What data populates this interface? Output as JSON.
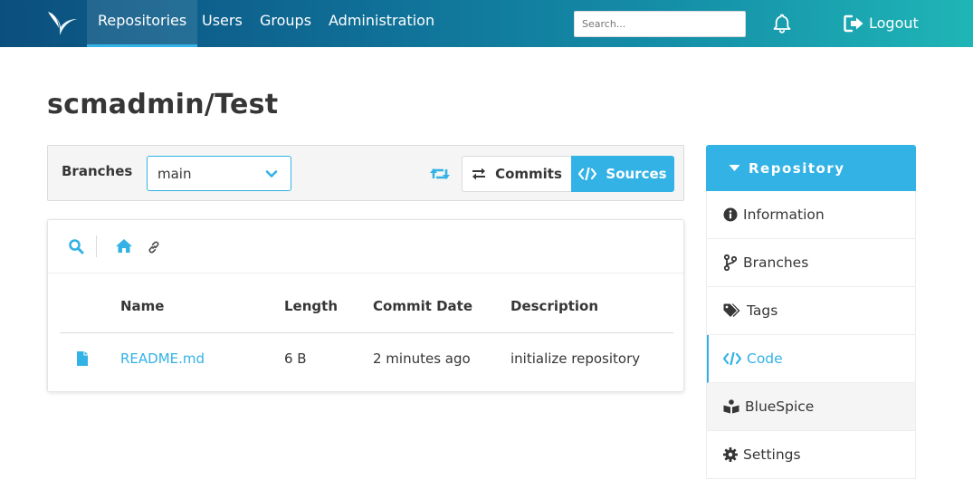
{
  "navbar": {
    "items": [
      {
        "label": "Repositories",
        "active": true
      },
      {
        "label": "Users",
        "active": false
      },
      {
        "label": "Groups",
        "active": false
      },
      {
        "label": "Administration",
        "active": false
      }
    ],
    "search_placeholder": "Search...",
    "logout_label": "Logout",
    "icons": {
      "logo": "scm-manager-logo",
      "bell": "bell-icon",
      "logout": "sign-out-icon"
    }
  },
  "page": {
    "title": "scmadmin/Test"
  },
  "branch_bar": {
    "label": "Branches",
    "selected_branch": "main",
    "commits_label": "Commits",
    "sources_label": "Sources",
    "active_view": "Sources"
  },
  "file_table": {
    "columns": [
      "Name",
      "Length",
      "Commit Date",
      "Description"
    ],
    "rows": [
      {
        "icon": "file-icon",
        "name": "README.md",
        "length": "6 B",
        "commit_date": "2 minutes ago",
        "description": "initialize repository"
      }
    ]
  },
  "repo_menu": {
    "header": "Repository",
    "items": [
      {
        "label": "Information",
        "icon": "info-circle-icon",
        "active": false
      },
      {
        "label": "Branches",
        "icon": "code-branch-icon",
        "active": false
      },
      {
        "label": "Tags",
        "icon": "tags-icon",
        "active": false
      },
      {
        "label": "Code",
        "icon": "code-icon",
        "active": true
      },
      {
        "label": "BlueSpice",
        "icon": "book-reader-icon",
        "active": false
      },
      {
        "label": "Settings",
        "icon": "cog-icon",
        "active": false
      }
    ]
  },
  "colors": {
    "accent": "#33b2e5",
    "nav_gradient_start": "#0b4f7e",
    "nav_gradient_end": "#1fb5b6",
    "text": "#363636"
  }
}
